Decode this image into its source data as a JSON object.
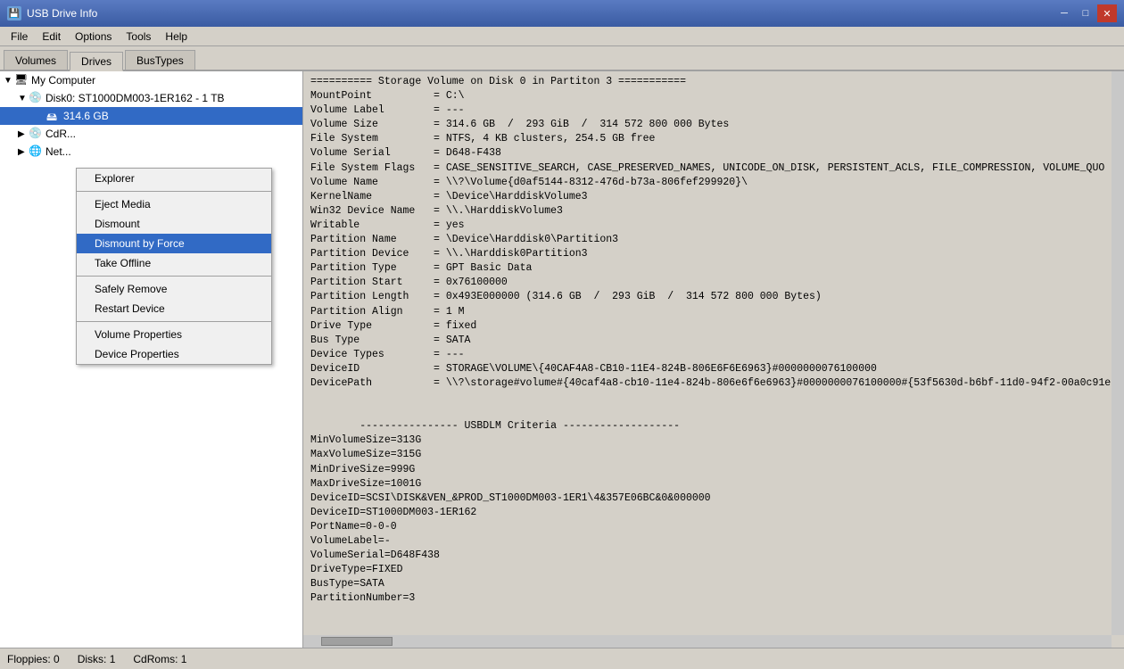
{
  "titleBar": {
    "title": "USB Drive Info",
    "icon": "💾"
  },
  "menuBar": {
    "items": [
      "File",
      "Edit",
      "Options",
      "Tools",
      "Help"
    ]
  },
  "tabs": [
    {
      "label": "Volumes",
      "active": false
    },
    {
      "label": "Drives",
      "active": true
    },
    {
      "label": "BusTypes",
      "active": false
    }
  ],
  "tree": {
    "myComputer": "My Computer",
    "disk0": "Disk0: ST1000DM003-1ER162 - 1 TB",
    "partition": "314.6 GB",
    "cdRom": "CdR...",
    "network": "Net..."
  },
  "contextMenu": {
    "items": [
      {
        "label": "Explorer",
        "separator_after": false
      },
      {
        "label": "Eject Media",
        "separator_after": false
      },
      {
        "label": "Dismount",
        "separator_after": false
      },
      {
        "label": "Dismount by Force",
        "active": true,
        "separator_after": false
      },
      {
        "label": "Take Offline",
        "separator_after": true
      },
      {
        "label": "Safely Remove",
        "separator_after": false
      },
      {
        "label": "Restart Device",
        "separator_after": true
      },
      {
        "label": "Volume Properties",
        "separator_after": false
      },
      {
        "label": "Device Properties",
        "separator_after": false
      }
    ]
  },
  "infoPanel": {
    "content": "========== Storage Volume on Disk 0 in Partiton 3 ===========\nMountPoint          = C:\\\nVolume Label        = ---\nVolume Size         = 314.6 GB  /  293 GiB  /  314 572 800 000 Bytes\nFile System         = NTFS, 4 KB clusters, 254.5 GB free\nVolume Serial       = D648-F438\nFile System Flags   = CASE_SENSITIVE_SEARCH, CASE_PRESERVED_NAMES, UNICODE_ON_DISK, PERSISTENT_ACLS, FILE_COMPRESSION, VOLUME_QUO\nVolume Name         = \\\\?\\Volume{d0af5144-8312-476d-b73a-806fef299920}\\\nKernelName          = \\Device\\HarddiskVolume3\nWin32 Device Name   = \\\\.\\HarddiskVolume3\nWritable            = yes\nPartition Name      = \\Device\\Harddisk0\\Partition3\nPartition Device    = \\\\.\\Harddisk0Partition3\nPartition Type      = GPT Basic Data\nPartition Start     = 0x76100000\nPartition Length    = 0x493E000000 (314.6 GB  /  293 GiB  /  314 572 800 000 Bytes)\nPartition Align     = 1 M\nDrive Type          = fixed\nBus Type            = SATA\nDevice Types        = ---\nDeviceID            = STORAGE\\VOLUME\\{40CAF4A8-CB10-11E4-824B-806E6F6E6963}#0000000076100000\nDevicePath          = \\\\?\\storage#volume#{40caf4a8-cb10-11e4-824b-806e6f6e6963}#0000000076100000#{53f5630d-b6bf-11d0-94f2-00a0c91e\n\n\n        ---------------- USBDLM Criteria -------------------\nMinVolumeSize=313G\nMaxVolumeSize=315G\nMinDriveSize=999G\nMaxDriveSize=1001G\nDeviceID=SCSI\\DISK&VEN_&PROD_ST1000DM003-1ER1\\4&357E06BC&0&000000\nDeviceID=ST1000DM003-1ER162\nPortName=0-0-0\nVolumeLabel=-\nVolumeSerial=D648F438\nDriveType=FIXED\nBusType=SATA\nPartitionNumber=3"
  },
  "statusBar": {
    "floppies": "Floppies: 0",
    "disks": "Disks: 1",
    "cdRoms": "CdRoms: 1"
  },
  "buttons": {
    "minimize": "─",
    "restore": "□",
    "close": "✕"
  }
}
